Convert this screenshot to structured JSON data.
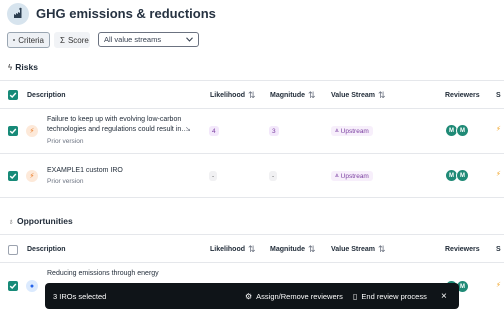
{
  "header": {
    "title": "GHG emissions & reductions",
    "logo_icon": "cloud-factory-icon"
  },
  "controls": {
    "criteria_label": "Criteria",
    "score_label": "Score",
    "value_stream_select": "All value streams"
  },
  "columns": {
    "description": "Description",
    "likelihood": "Likelihood",
    "magnitude": "Magnitude",
    "value_stream": "Value Stream",
    "reviewers": "Reviewers",
    "status_partial": "S"
  },
  "risks": {
    "title": "Risks",
    "rows": [
      {
        "selected": true,
        "description": "Failure to keep up with evolving low-carbon technologies and regulations could result in…",
        "prior": "Prior version",
        "likelihood": "4",
        "magnitude": "3",
        "value_stream": "Upstream",
        "reviewers": [
          "M",
          "M"
        ]
      },
      {
        "selected": true,
        "description": "EXAMPLE1 custom IRO",
        "prior": "Prior version",
        "likelihood": "-",
        "magnitude": "-",
        "value_stream": "Upstream",
        "reviewers": [
          "M",
          "M"
        ]
      }
    ]
  },
  "opportunities": {
    "title": "Opportunities",
    "rows": [
      {
        "selected": true,
        "description": "Reducing emissions through energy"
      }
    ]
  },
  "action_bar": {
    "selected_text": "3 IROs selected",
    "assign_label": "Assign/Remove reviewers",
    "end_label": "End review process",
    "close_symbol": "×"
  },
  "colors": {
    "accent": "#178a78",
    "chip_text": "#7a3ea0",
    "bar_bg": "#0f1418"
  }
}
